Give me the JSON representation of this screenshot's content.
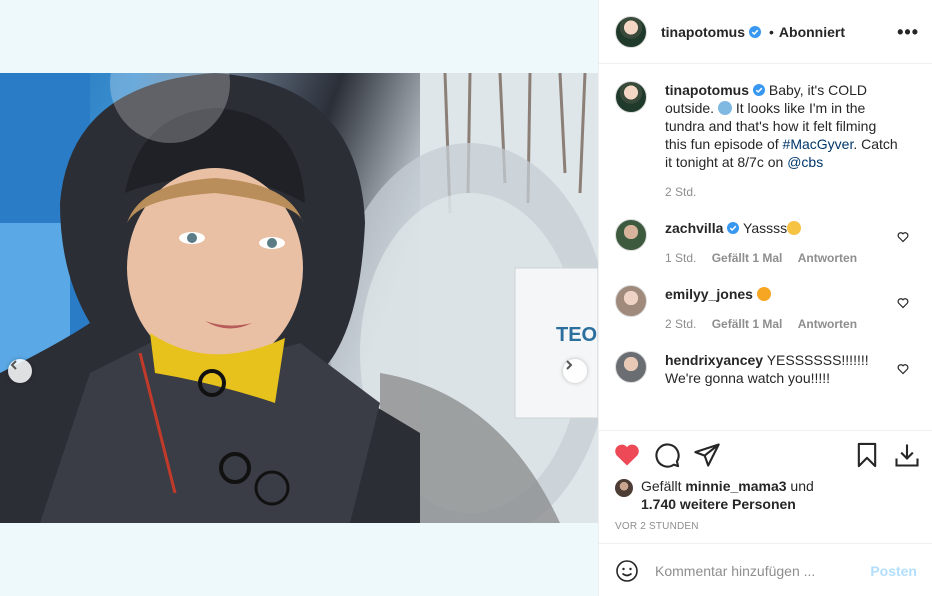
{
  "post": {
    "author": "tinapotomus",
    "follow_state": "Abonniert",
    "header_sep": "•",
    "more_label": "•••"
  },
  "caption": {
    "username": "tinapotomus",
    "text_before_emoji": "Baby, it's COLD outside.",
    "text_after_emoji": "It looks like I'm in the tundra and that's how it felt filming this fun episode of",
    "hashtag": "#MacGyver",
    "text_after_hashtag": ". Catch it tonight at 8/7c on",
    "mention": "@cbs",
    "time": "2 Std."
  },
  "comments": [
    {
      "username": "zachvilla",
      "verified": true,
      "text": "Yassss",
      "time": "1 Std.",
      "likes": "Gefällt 1 Mal",
      "reply": "Antworten"
    },
    {
      "username": "emilyy_jones",
      "verified": false,
      "text": "",
      "time": "2 Std.",
      "likes": "Gefällt 1 Mal",
      "reply": "Antworten"
    },
    {
      "username": "hendrixyancey",
      "verified": false,
      "text": "YESSSSSS!!!!!!! We're gonna watch you!!!!!"
    }
  ],
  "likes": {
    "prefix": "Gefällt",
    "first_liker": "minnie_mama3",
    "conj": "und",
    "others": "1.740 weitere Personen"
  },
  "timestamp": "VOR 2 STUNDEN",
  "composer": {
    "placeholder": "Kommentar hinzufügen ...",
    "post_label": "Posten"
  },
  "photo_sign_text": "TEO",
  "colors": {
    "accent": "#ed4956",
    "link": "#00376b",
    "verified": "#3897f0",
    "post_disabled": "#b2dffc"
  }
}
